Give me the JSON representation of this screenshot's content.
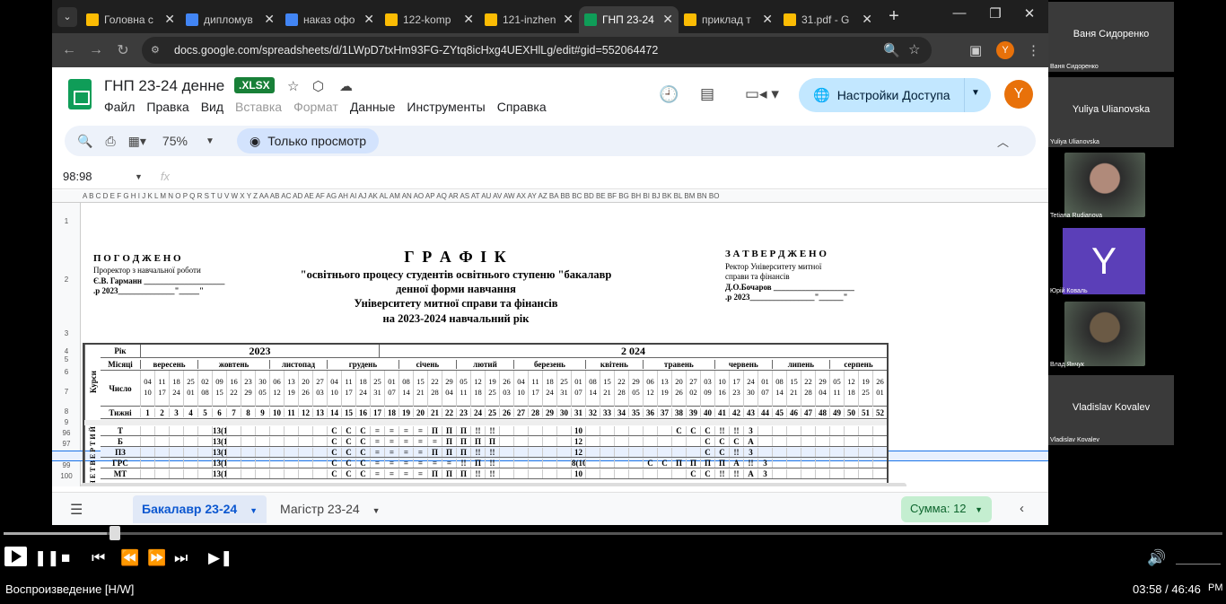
{
  "tabs": [
    {
      "label": "Головна с",
      "color": "#fbbc04",
      "active": false
    },
    {
      "label": "дипломув",
      "color": "#4285f4",
      "active": false
    },
    {
      "label": "наказ офо",
      "color": "#4285f4",
      "active": false
    },
    {
      "label": "122-komp",
      "color": "#fbbc04",
      "active": false
    },
    {
      "label": "121-inzhen",
      "color": "#fbbc04",
      "active": false
    },
    {
      "label": "ГНП 23-24",
      "color": "#0f9d58",
      "active": true
    },
    {
      "label": "приклад т",
      "color": "#fbbc04",
      "active": false
    },
    {
      "label": "31.pdf - G",
      "color": "#fbbc04",
      "active": false
    }
  ],
  "url": "docs.google.com/spreadsheets/d/1LWpD7txHm93FG-ZYtq8icHxg4UEXHlLg/edit#gid=552064472",
  "profile_initial": "Y",
  "sheets": {
    "title": "ГНП 23-24 денне",
    "badge": ".XLSX",
    "menus": [
      "Файл",
      "Правка",
      "Вид",
      "Вставка",
      "Формат",
      "Данные",
      "Инструменты",
      "Справка"
    ],
    "share_label": "Настройки Доступа",
    "zoom": "75%",
    "mode": "Только просмотр",
    "cell_ref": "98:98",
    "fx": "fx",
    "sheet_tabs": [
      "Бакалавр 23-24",
      "Магістр 23-24"
    ],
    "sum": "Сумма: 12"
  },
  "grid": {
    "columns": "A B C D E F G H I J K L M N O P Q R S T U V W X Y Z AA AB AC AD AE AF AG AH AI AJ AK AL AM AN AO AP AQ AR AS AT AU AV AW AX AY AZ BA BB BC BD BE BF BG BH BI BJ BK BL BM BN BO",
    "row_numbers": [
      "1",
      "2",
      "3",
      "4",
      "5",
      "6",
      "7",
      "8",
      "9",
      "96",
      "97",
      "98",
      "99",
      "100"
    ],
    "left_block": [
      "П О Г О Д Ж Е Н О",
      "Проректор  з  навчальної роботи",
      "Є.В. Гарманн ____________________",
      ".р 2023______________\"_____\""
    ],
    "center_block": [
      "Г Р А Ф І К",
      "\"освітнього процесу  студентів освітнього ступеню \"бакалавр",
      "денної форми навчання",
      "Університету митної справи та фінансів",
      "на 2023-2024  навчальний рік"
    ],
    "right_block": [
      "З А Т В Е Р Д Ж Е Н О",
      "Ректор Університету митної",
      "справи та фінансів",
      "Д.О.Бочаров ____________________",
      ".р  2023________________\"______\""
    ]
  },
  "schedule": {
    "kursy": "Курси",
    "rik_label": "Рік",
    "year1": "2023",
    "year2": "2 024",
    "misiatsi_label": "Місяці",
    "months": [
      "вересень",
      "жовтень",
      "листопад",
      "грудень",
      "січень",
      "лютий",
      "березень",
      "квітень",
      "травень",
      "червень",
      "липень",
      "серпень"
    ],
    "chyslo_label": "Число",
    "dates_top": [
      "04",
      "11",
      "18",
      "25",
      "02",
      "09",
      "16",
      "23",
      "30",
      "06",
      "13",
      "20",
      "27",
      "04",
      "11",
      "18",
      "25",
      "01",
      "08",
      "15",
      "22",
      "29",
      "05",
      "12",
      "19",
      "26",
      "04",
      "11",
      "18",
      "25",
      "01",
      "08",
      "15",
      "22",
      "29",
      "06",
      "13",
      "20",
      "27",
      "03",
      "10",
      "17",
      "24",
      "01",
      "08",
      "15",
      "22",
      "29",
      "05",
      "12",
      "19",
      "26"
    ],
    "dates_bottom": [
      "10",
      "17",
      "24",
      "01",
      "08",
      "15",
      "22",
      "29",
      "05",
      "12",
      "19",
      "26",
      "03",
      "10",
      "17",
      "24",
      "31",
      "07",
      "14",
      "21",
      "28",
      "04",
      "11",
      "18",
      "25",
      "03",
      "10",
      "17",
      "24",
      "31",
      "07",
      "14",
      "21",
      "28",
      "05",
      "12",
      "19",
      "26",
      "02",
      "09",
      "16",
      "23",
      "30",
      "07",
      "14",
      "21",
      "28",
      "04",
      "11",
      "18",
      "25",
      "01"
    ],
    "tyzhni_label": "Тижні",
    "weeks": [
      "1",
      "2",
      "3",
      "4",
      "5",
      "6",
      "7",
      "8",
      "9",
      "10",
      "11",
      "12",
      "13",
      "14",
      "15",
      "16",
      "17",
      "18",
      "19",
      "20",
      "21",
      "22",
      "23",
      "24",
      "25",
      "26",
      "27",
      "28",
      "29",
      "30",
      "31",
      "32",
      "33",
      "34",
      "35",
      "36",
      "37",
      "38",
      "39",
      "40",
      "41",
      "42",
      "43",
      "44",
      "45",
      "46",
      "47",
      "48",
      "49",
      "50",
      "51",
      "52"
    ],
    "course_vertical": "Ч Е Т В Е Р Т И Й",
    "rows": [
      {
        "label": "Т",
        "cells": [
          "",
          "",
          "",
          "",
          "",
          "13(15)",
          "",
          "",
          "",
          "",
          "",
          "",
          "",
          "С",
          "С",
          "С",
          "=",
          "=",
          "=",
          "=",
          "П",
          "П",
          "П",
          "!!",
          "!!",
          "",
          "",
          "",
          "",
          "",
          "10",
          "",
          "",
          "",
          "",
          "",
          "",
          "С",
          "С",
          "С",
          "!!",
          "!!",
          "3",
          "",
          "",
          "",
          "",
          "",
          "",
          "",
          "",
          ""
        ]
      },
      {
        "label": "Б",
        "cells": [
          "",
          "",
          "",
          "",
          "",
          "13(15)",
          "",
          "",
          "",
          "",
          "",
          "",
          "",
          "С",
          "С",
          "С",
          "=",
          "=",
          "=",
          "=",
          "=",
          "П",
          "П",
          "П",
          "П",
          "",
          "",
          "",
          "",
          "",
          "12",
          "",
          "",
          "",
          "",
          "",
          "",
          "",
          "",
          "С",
          "С",
          "С",
          "А",
          "",
          "",
          "",
          "",
          "",
          "",
          "",
          "",
          ""
        ]
      },
      {
        "label": "ПЗ",
        "cells": [
          "",
          "",
          "",
          "",
          "",
          "13(15)",
          "",
          "",
          "",
          "",
          "",
          "",
          "",
          "С",
          "С",
          "С",
          "=",
          "=",
          "=",
          "=",
          "П",
          "П",
          "П",
          "!!",
          "!!",
          "",
          "",
          "",
          "",
          "",
          "12",
          "",
          "",
          "",
          "",
          "",
          "",
          "",
          "",
          "С",
          "С",
          "!!",
          "3",
          "",
          "",
          "",
          "",
          "",
          "",
          "",
          "",
          ""
        ]
      },
      {
        "label": "ГРС",
        "cells": [
          "",
          "",
          "",
          "",
          "",
          "13(15)",
          "",
          "",
          "",
          "",
          "",
          "",
          "",
          "С",
          "С",
          "С",
          "=",
          "=",
          "=",
          "=",
          "=",
          "=",
          "!!",
          "П",
          "!!",
          "",
          "",
          "",
          "",
          "",
          "8(10)",
          "",
          "",
          "",
          "",
          "С",
          "С",
          "П",
          "П",
          "П",
          "П",
          "А",
          "!!",
          "3",
          "",
          "",
          "",
          "",
          "",
          "",
          "",
          ""
        ]
      },
      {
        "label": "МТ",
        "cells": [
          "",
          "",
          "",
          "",
          "",
          "13(15)",
          "",
          "",
          "",
          "",
          "",
          "",
          "",
          "С",
          "С",
          "С",
          "=",
          "=",
          "=",
          "=",
          "П",
          "П",
          "П",
          "!!",
          "!!",
          "",
          "",
          "",
          "",
          "",
          "10",
          "",
          "",
          "",
          "",
          "",
          "",
          "",
          "С",
          "С",
          "!!",
          "!!",
          "А",
          "3",
          "",
          "",
          "",
          "",
          "",
          "",
          "",
          ""
        ]
      }
    ]
  },
  "participants": [
    {
      "name": "Ваня Сидоренко",
      "sub": "Ваня Сидоренко",
      "kind": "name"
    },
    {
      "name": "Yuliya Ulianovska",
      "sub": "Yuliya Ulianovska",
      "kind": "name"
    },
    {
      "name": "",
      "sub": "Tetiana Rudianova",
      "kind": "photo",
      "color": "#b08a7a"
    },
    {
      "name": "Y",
      "sub": "Юрій Коваль",
      "kind": "avatar",
      "color": "#5b3fb8"
    },
    {
      "name": "",
      "sub": "Влад Янчук",
      "kind": "photo",
      "color": "#6b5a45"
    },
    {
      "name": "Vladislav Kovalev",
      "sub": "Vladislav Kovalev",
      "kind": "name"
    }
  ],
  "player": {
    "status": "Воспроизведение [H/W]",
    "time": "03:58 / 46:46",
    "progress_pct": 8.5
  }
}
